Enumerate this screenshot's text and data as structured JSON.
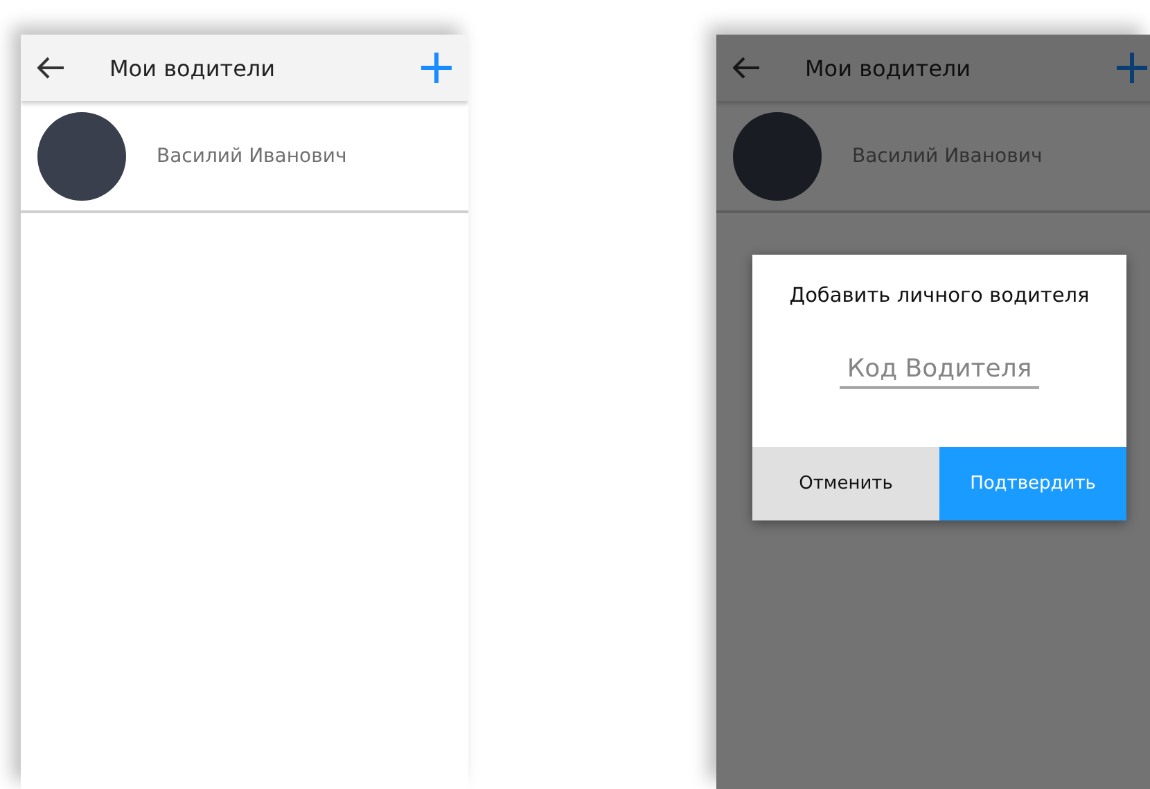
{
  "screens": [
    {
      "header": {
        "title": "Мои водители"
      },
      "drivers": [
        {
          "name": "Василий Иванович"
        }
      ]
    },
    {
      "header": {
        "title": "Мои водители"
      },
      "drivers": [
        {
          "name": "Василий Иванович"
        }
      ],
      "dialog": {
        "title": "Добавить личного водителя",
        "placeholder": "Код Водителя",
        "buttons": [
          {
            "label": "Отменить",
            "kind": "cancel"
          },
          {
            "label": "Подтвердить",
            "kind": "confirm"
          }
        ]
      }
    }
  ]
}
